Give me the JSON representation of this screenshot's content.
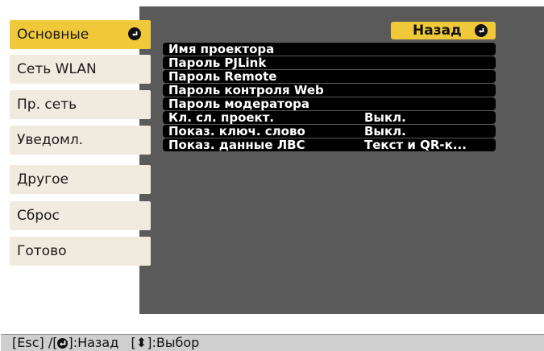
{
  "sidebar": {
    "items": [
      {
        "label": "Основные",
        "active": true
      },
      {
        "label": "Сеть WLAN",
        "active": false
      },
      {
        "label": "Пр. сеть",
        "active": false
      },
      {
        "label": "Уведомл.",
        "active": false
      },
      {
        "label": "Другое",
        "active": false
      },
      {
        "label": "Сброс",
        "active": false
      },
      {
        "label": "Готово",
        "active": false
      }
    ]
  },
  "main": {
    "back_label": "Назад",
    "rows": [
      {
        "label": "Имя проектора",
        "value": ""
      },
      {
        "label": "Пароль PJLink",
        "value": ""
      },
      {
        "label": "Пароль Remote",
        "value": ""
      },
      {
        "label": "Пароль контроля Web",
        "value": ""
      },
      {
        "label": "Пароль модератора",
        "value": ""
      },
      {
        "label": "Кл. сл. проект.",
        "value": "Выкл."
      },
      {
        "label": "Показ. ключ. слово",
        "value": "Выкл."
      },
      {
        "label": "Показ. данные ЛВС",
        "value": "Текст и QR-к..."
      }
    ]
  },
  "footer": {
    "esc_text": "[Esc] /[",
    "back_text": "]:Назад",
    "select_open": "   [",
    "select_icon": "⬍",
    "select_text": "]:Выбор"
  },
  "colors": {
    "accent": "#f0c93a",
    "panel": "#5a5a5a",
    "row": "#000000",
    "inactive_item": "#f1eadf"
  },
  "icons": [
    "enter-icon",
    "up-down-arrows-icon"
  ]
}
